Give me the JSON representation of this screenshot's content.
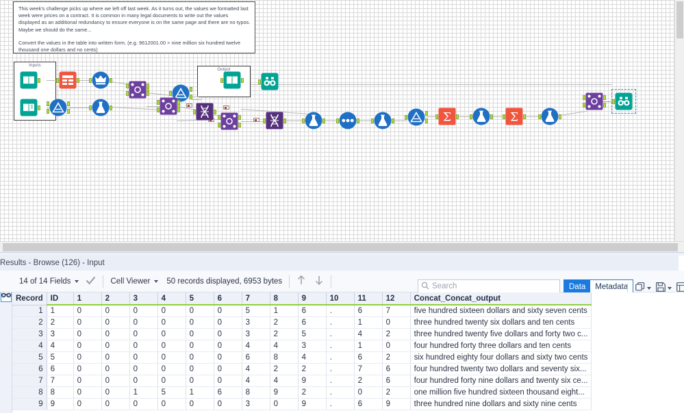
{
  "comment": {
    "paragraph1": "This week's challenge picks up where we left off last week. As it turns out, the values we formatted last week were prices on a contract. It is common in many legal documents to write out the values displayed as an additional redundancy to ensure everyone is on the same page and there are no typos. Maybe we should do the same...",
    "paragraph2": "Convert the values in the table into written form.  (e.g. 9612001.00 > nine million six hundred twelve thousand one dollars and no cents)"
  },
  "canvas": {
    "containers": [
      {
        "name": "inputs-container",
        "title": "Inputs"
      },
      {
        "name": "output-container",
        "title": "Output"
      }
    ],
    "tools": [
      {
        "name": "input-data-1",
        "icon": "input-data-icon"
      },
      {
        "name": "input-data-2",
        "icon": "input-data-icon"
      },
      {
        "name": "text-input",
        "icon": "text-input-icon"
      },
      {
        "name": "select-records",
        "icon": "crown-icon"
      },
      {
        "name": "union-1",
        "icon": "union-icon"
      },
      {
        "name": "formula-1",
        "icon": "formula-icon"
      },
      {
        "name": "join-1",
        "icon": "join-icon"
      },
      {
        "name": "join-2",
        "icon": "join-icon"
      },
      {
        "name": "union-2",
        "icon": "union-icon"
      },
      {
        "name": "transpose-1",
        "icon": "transpose-icon"
      },
      {
        "name": "join-3",
        "icon": "join-icon"
      },
      {
        "name": "transpose-2",
        "icon": "transpose-icon"
      },
      {
        "name": "formula-2",
        "icon": "formula-icon"
      },
      {
        "name": "multi-row-formula",
        "icon": "multi-field-icon"
      },
      {
        "name": "formula-3",
        "icon": "formula-icon"
      },
      {
        "name": "union-3",
        "icon": "union-icon"
      },
      {
        "name": "summarize-1",
        "icon": "summarize-icon"
      },
      {
        "name": "formula-4",
        "icon": "formula-icon"
      },
      {
        "name": "summarize-2",
        "icon": "summarize-icon"
      },
      {
        "name": "formula-5",
        "icon": "formula-icon"
      },
      {
        "name": "join-4",
        "icon": "join-icon"
      },
      {
        "name": "browse-output",
        "icon": "browse-icon"
      },
      {
        "name": "browse-final",
        "icon": "browse-icon",
        "selected": true
      }
    ]
  },
  "results": {
    "title": "Results - Browse (126) - Input",
    "toolbar": {
      "fields_label": "14 of 14 Fields",
      "viewer_label": "Cell Viewer",
      "records_label": "50 records displayed, 6953 bytes",
      "search_placeholder": "Search",
      "search_value": "",
      "data_tab": "Data",
      "metadata_tab": "Metadata",
      "active_tab": "Data"
    },
    "columns": [
      "Record",
      "ID",
      "1",
      "2",
      "3",
      "4",
      "5",
      "6",
      "7",
      "8",
      "9",
      "10",
      "11",
      "12",
      "Concat_Concat_output"
    ],
    "rows": [
      {
        "record": "1",
        "id": "1",
        "c": [
          "0",
          "0",
          "0",
          "0",
          "0",
          "0",
          "5",
          "1",
          "6",
          ".",
          "6",
          "7"
        ],
        "concat": "five hundred sixteen dollars and sixty seven cents"
      },
      {
        "record": "2",
        "id": "2",
        "c": [
          "0",
          "0",
          "0",
          "0",
          "0",
          "0",
          "3",
          "2",
          "6",
          ".",
          "1",
          "0"
        ],
        "concat": "three hundred twenty six dollars and ten cents"
      },
      {
        "record": "3",
        "id": "3",
        "c": [
          "0",
          "0",
          "0",
          "0",
          "0",
          "0",
          "3",
          "2",
          "5",
          ".",
          "4",
          "2"
        ],
        "concat": "three hundred twenty five dollars and forty two c..."
      },
      {
        "record": "4",
        "id": "4",
        "c": [
          "0",
          "0",
          "0",
          "0",
          "0",
          "0",
          "4",
          "4",
          "3",
          ".",
          "1",
          "0"
        ],
        "concat": "four hundred forty three dollars and ten cents"
      },
      {
        "record": "5",
        "id": "5",
        "c": [
          "0",
          "0",
          "0",
          "0",
          "0",
          "0",
          "6",
          "8",
          "4",
          ".",
          "6",
          "2"
        ],
        "concat": "six hundred eighty four dollars and sixty two cents"
      },
      {
        "record": "6",
        "id": "6",
        "c": [
          "0",
          "0",
          "0",
          "0",
          "0",
          "0",
          "4",
          "2",
          "2",
          ".",
          "7",
          "6"
        ],
        "concat": "four hundred twenty two dollars and seventy six..."
      },
      {
        "record": "7",
        "id": "7",
        "c": [
          "0",
          "0",
          "0",
          "0",
          "0",
          "0",
          "4",
          "4",
          "9",
          ".",
          "2",
          "6"
        ],
        "concat": "four hundred forty nine dollars and twenty six ce..."
      },
      {
        "record": "8",
        "id": "8",
        "c": [
          "0",
          "0",
          "1",
          "5",
          "1",
          "6",
          "8",
          "9",
          "2",
          ".",
          "0",
          "2"
        ],
        "concat": "one million five hundred sixteen thousand eight..."
      },
      {
        "record": "9",
        "id": "9",
        "c": [
          "0",
          "0",
          "0",
          "0",
          "0",
          "0",
          "3",
          "0",
          "9",
          ".",
          "6",
          "9"
        ],
        "concat": "three hundred nine dollars and sixty nine cents"
      }
    ]
  }
}
